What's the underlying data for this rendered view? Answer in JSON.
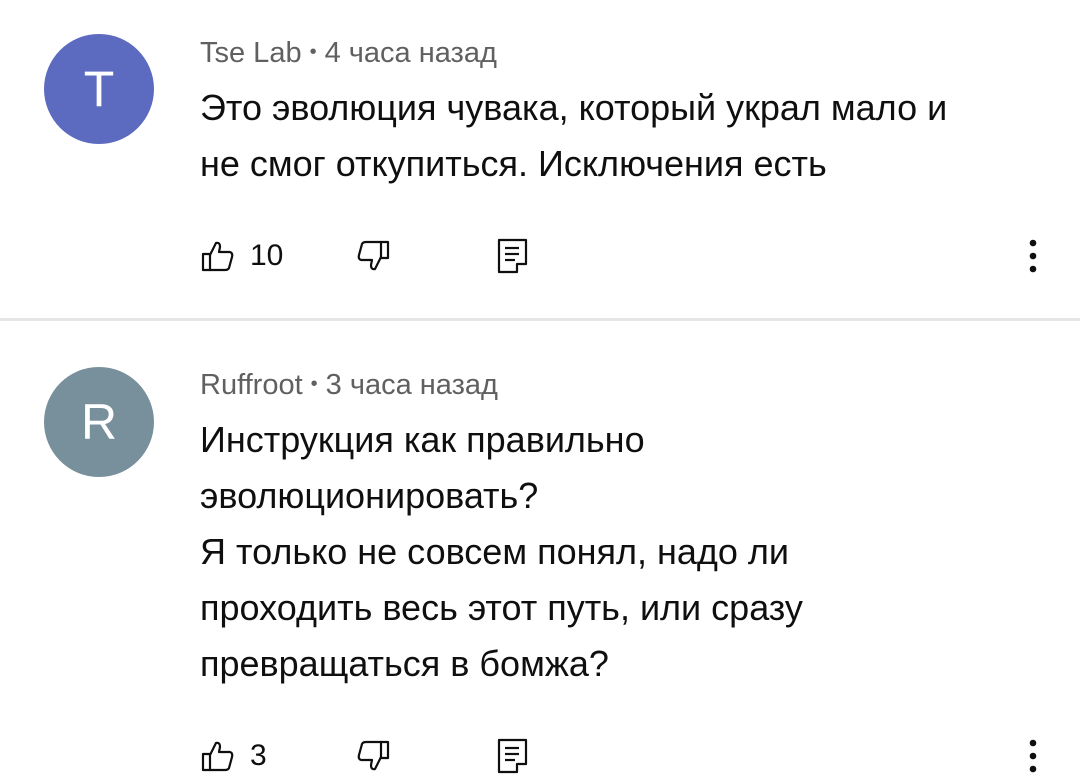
{
  "colors": {
    "avatar_t": "#5c6bc0",
    "avatar_r": "#78909c",
    "meta_text": "#606060",
    "body_text": "#0f0f0f",
    "divider": "#e6e6e6"
  },
  "comments": [
    {
      "avatar_letter": "T",
      "author": "Tse Lab",
      "separator": "•",
      "time": "4 часа назад",
      "lines": [
        "Это эволюция чувака, который украл мало и",
        "не смог откупиться. Исключения есть"
      ],
      "likes": "10",
      "icons": {
        "like": "thumb-up-icon",
        "dislike": "thumb-down-icon",
        "reply": "reply-icon",
        "more": "more-vert-icon"
      }
    },
    {
      "avatar_letter": "R",
      "author": "Ruffroot",
      "separator": "•",
      "time": "3 часа назад",
      "lines": [
        "Инструкция как правильно",
        "эволюционировать?",
        "Я только не совсем понял, надо ли",
        "проходить весь этот путь, или сразу",
        "превращаться в бомжа?"
      ],
      "likes": "3",
      "icons": {
        "like": "thumb-up-icon",
        "dislike": "thumb-down-icon",
        "reply": "reply-icon",
        "more": "more-vert-icon"
      }
    }
  ]
}
